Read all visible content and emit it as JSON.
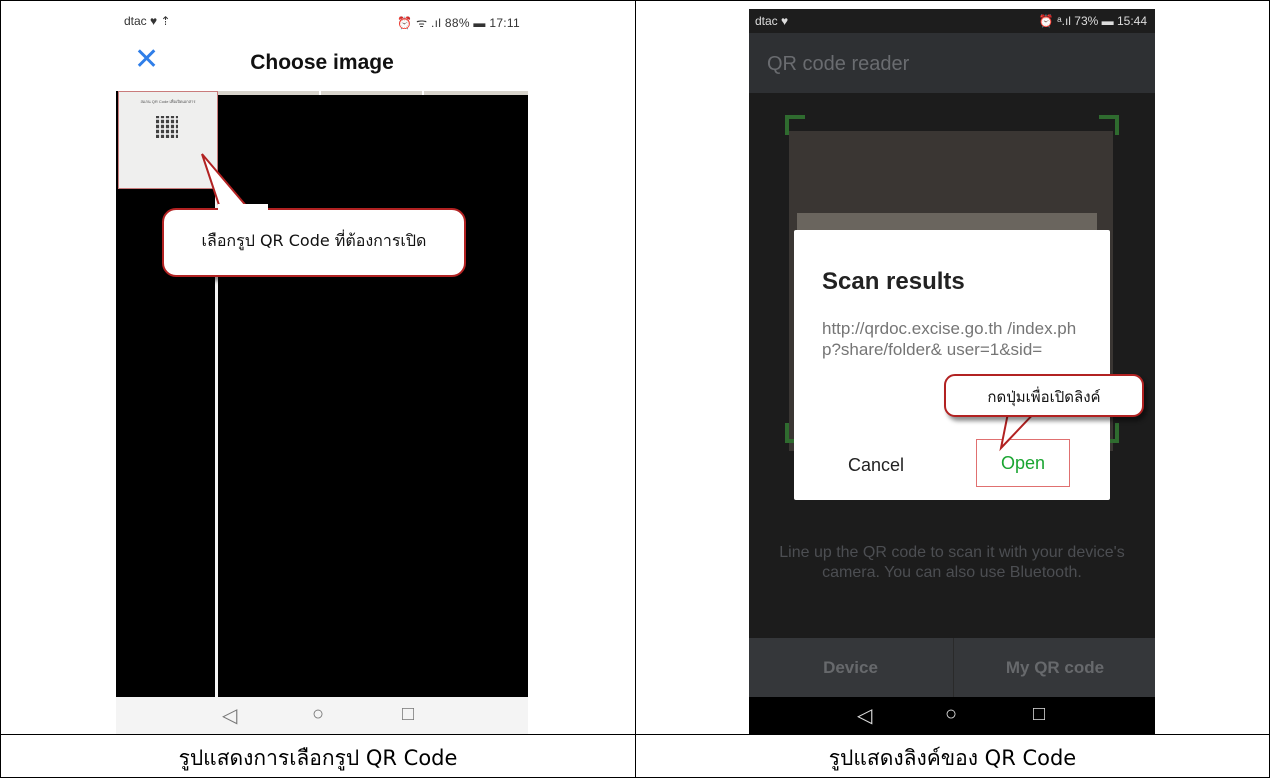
{
  "left_screen": {
    "status_bar": {
      "carrier": "dtac ♥ ⇡",
      "right": "⏰ ᯤ .ıl 88% ▬ 17:11"
    },
    "title": "Choose image",
    "close_icon": "close-icon",
    "thumbnail_text": "สแกน QR Code เพื่อเปิดเอกสาร",
    "callout": "เลือกรูป QR Code ที่ต้องการเปิด",
    "nav": {
      "back": "◁",
      "home": "○",
      "recent": "□"
    },
    "accent": "#2f7ee8"
  },
  "right_screen": {
    "status_bar": {
      "carrier": "dtac ♥",
      "right": "⏰ ᵃ.ıl 73% ▬ 15:44"
    },
    "title": "QR code reader",
    "dialog": {
      "title": "Scan results",
      "body": "http://qrdoc.excise.go.th /index.php?share/folder& user=1&sid=",
      "cancel": "Cancel",
      "open": "Open"
    },
    "callout": "กดปุ่มเพื่อเปิดลิงค์",
    "hint": "Line up the QR code to scan it with your device's camera. You can also use Bluetooth.",
    "tabs": [
      "Device",
      "My QR code"
    ],
    "nav": {
      "back": "◁",
      "home": "○",
      "recent": "□"
    },
    "open_color": "#1aa531"
  },
  "captions": {
    "left": "รูปแสดงการเลือกรูป QR Code",
    "right": "รูปแสดงลิงค์ของ QR Code"
  }
}
